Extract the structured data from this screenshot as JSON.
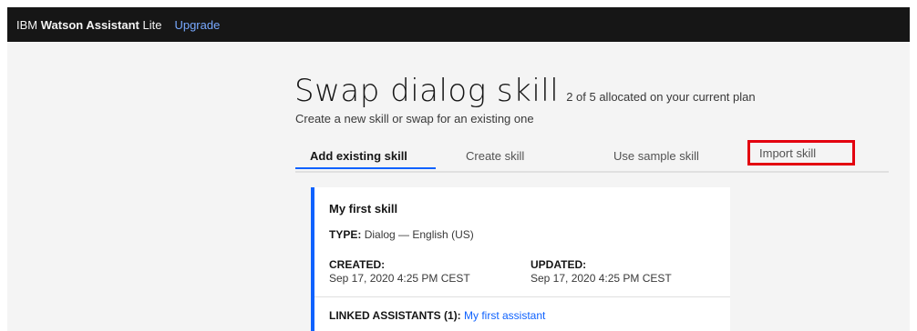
{
  "header": {
    "brand_prefix": "IBM",
    "brand_name": "Watson Assistant",
    "brand_suffix": "Lite",
    "upgrade_label": "Upgrade"
  },
  "page": {
    "title": "Swap dialog skill",
    "allocation": "2 of 5 allocated on your current plan",
    "subtitle": "Create a new skill or swap for an existing one"
  },
  "tabs": [
    {
      "label": "Add existing skill",
      "active": true
    },
    {
      "label": "Create skill",
      "active": false
    },
    {
      "label": "Use sample skill",
      "active": false
    },
    {
      "label": "Import skill",
      "active": false,
      "highlighted": true
    }
  ],
  "skill_card": {
    "title": "My first skill",
    "type_label": "TYPE:",
    "type_value": "Dialog — English (US)",
    "created_label": "CREATED:",
    "created_value": "Sep 17, 2020 4:25 PM CEST",
    "updated_label": "UPDATED:",
    "updated_value": "Sep 17, 2020 4:25 PM CEST",
    "linked_label": "LINKED ASSISTANTS (1):",
    "linked_value": "My first assistant"
  },
  "colors": {
    "topbar": "#161616",
    "accent": "#0f62fe",
    "highlight_box": "#e3000f",
    "background": "#f4f4f4"
  }
}
